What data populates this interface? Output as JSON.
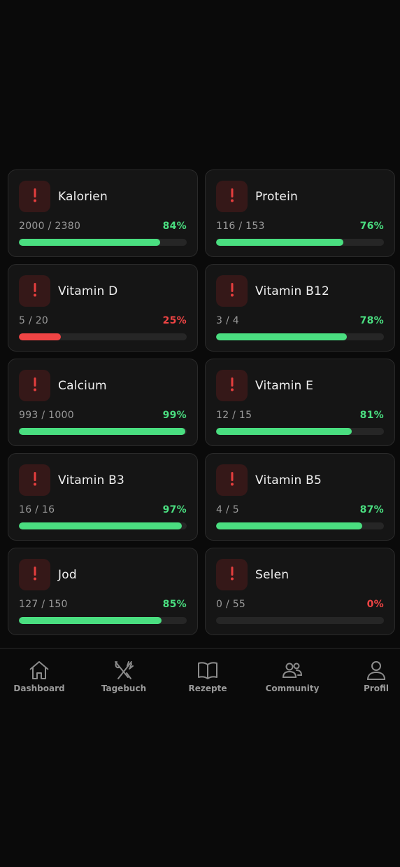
{
  "cards": [
    {
      "name": "Kalorien",
      "amount": "2000 / 2380",
      "percent": "84%",
      "fill": 0.84,
      "status": "ok"
    },
    {
      "name": "Protein",
      "amount": "116 / 153",
      "percent": "76%",
      "fill": 0.76,
      "status": "ok"
    },
    {
      "name": "Vitamin D",
      "amount": "5 / 20",
      "percent": "25%",
      "fill": 0.25,
      "status": "low"
    },
    {
      "name": "Vitamin B12",
      "amount": "3 / 4",
      "percent": "78%",
      "fill": 0.78,
      "status": "ok"
    },
    {
      "name": "Calcium",
      "amount": "993 / 1000",
      "percent": "99%",
      "fill": 0.99,
      "status": "ok"
    },
    {
      "name": "Vitamin E",
      "amount": "12 / 15",
      "percent": "81%",
      "fill": 0.81,
      "status": "ok"
    },
    {
      "name": "Vitamin B3",
      "amount": "16 / 16",
      "percent": "97%",
      "fill": 0.97,
      "status": "ok"
    },
    {
      "name": "Vitamin B5",
      "amount": "4 / 5",
      "percent": "87%",
      "fill": 0.87,
      "status": "ok"
    },
    {
      "name": "Jod",
      "amount": "127 / 150",
      "percent": "85%",
      "fill": 0.85,
      "status": "ok"
    },
    {
      "name": "Selen",
      "amount": "0 / 55",
      "percent": "0%",
      "fill": 0.0,
      "status": "low"
    }
  ],
  "colors": {
    "ok": "#4ade80",
    "low": "#ef4444",
    "warning_icon": "#e53e3e"
  },
  "card_icon": "exclamation-icon",
  "nav": {
    "items": [
      {
        "label": "Dashboard",
        "icon": "home-icon"
      },
      {
        "label": "Tagebuch",
        "icon": "fork-knife-icon"
      },
      {
        "label": "Rezepte",
        "icon": "book-icon"
      },
      {
        "label": "Community",
        "icon": "users-icon"
      },
      {
        "label": "Profil",
        "icon": "user-icon"
      }
    ]
  }
}
